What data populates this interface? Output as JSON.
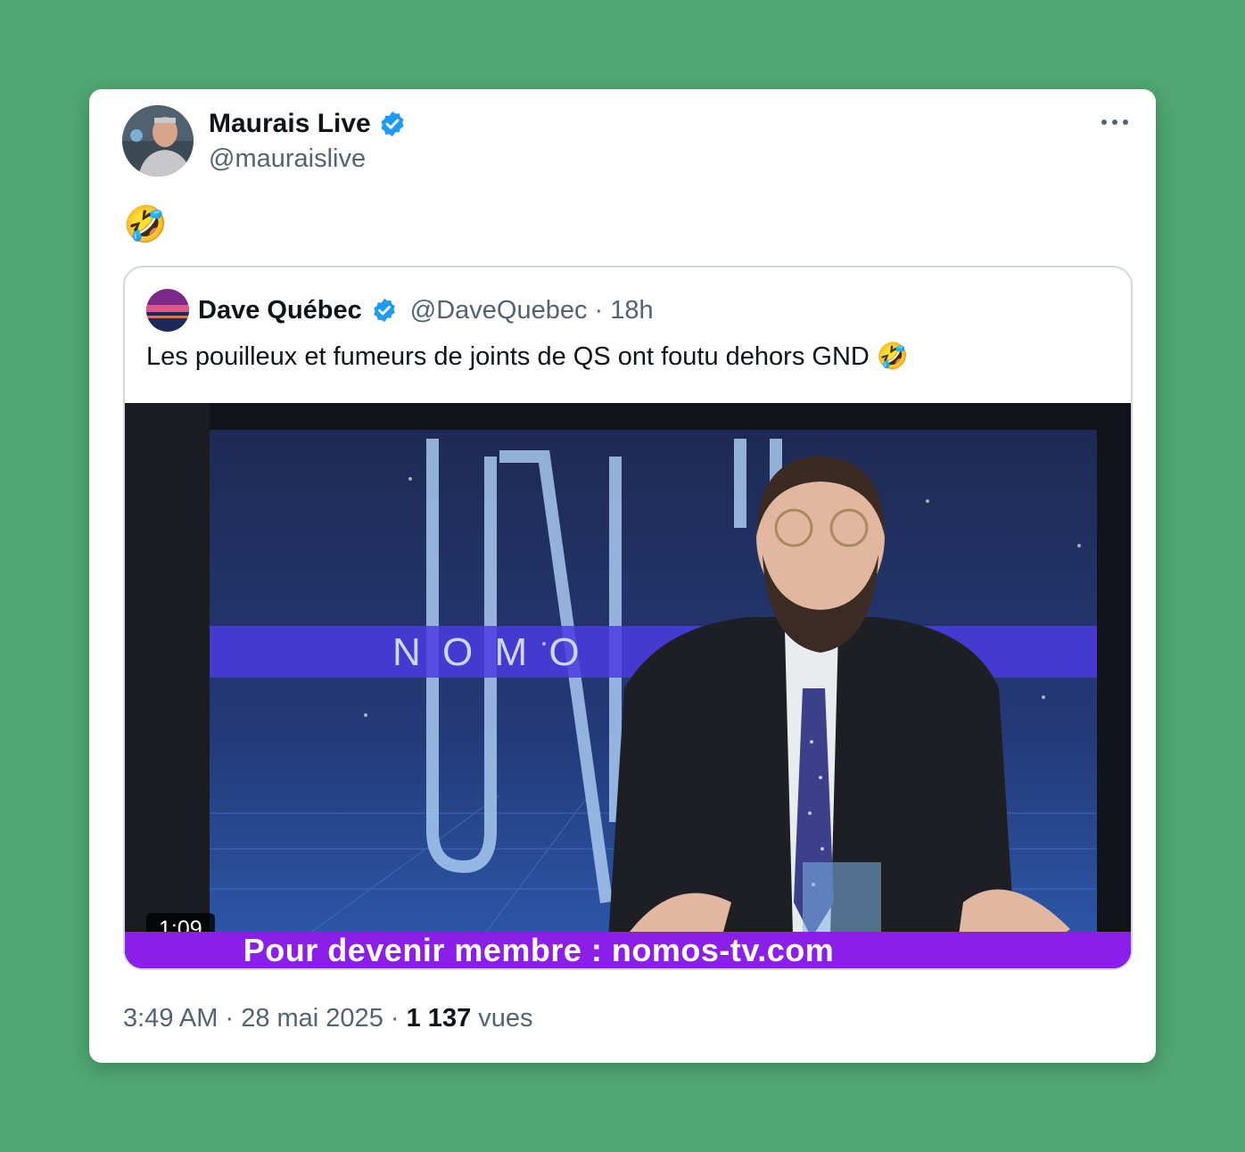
{
  "tweet": {
    "author": {
      "display_name": "Maurais Live",
      "handle": "@mauraislive",
      "verified": true
    },
    "text": "🤣",
    "more_icon": "more-horizontal-icon",
    "timestamp": "3:49 AM",
    "date": "28 mai 2025",
    "views_count": "1 137",
    "views_label": "vues",
    "separator": "·"
  },
  "quoted": {
    "author": {
      "display_name": "Dave Québec",
      "handle": "@DaveQuebec",
      "verified": true
    },
    "meta": "@DaveQuebec · 18h",
    "text": "Les pouilleux et fumeurs de joints de QS ont foutu dehors GND 🤣",
    "media": {
      "duration": "1:09",
      "screen_logo_text": "N O M O",
      "banner_text": "Pour devenir membre : nomos-tv.com"
    }
  },
  "colors": {
    "background": "#4fa771",
    "verified": "#1d9bf0",
    "banner": "#8b1ee8"
  }
}
